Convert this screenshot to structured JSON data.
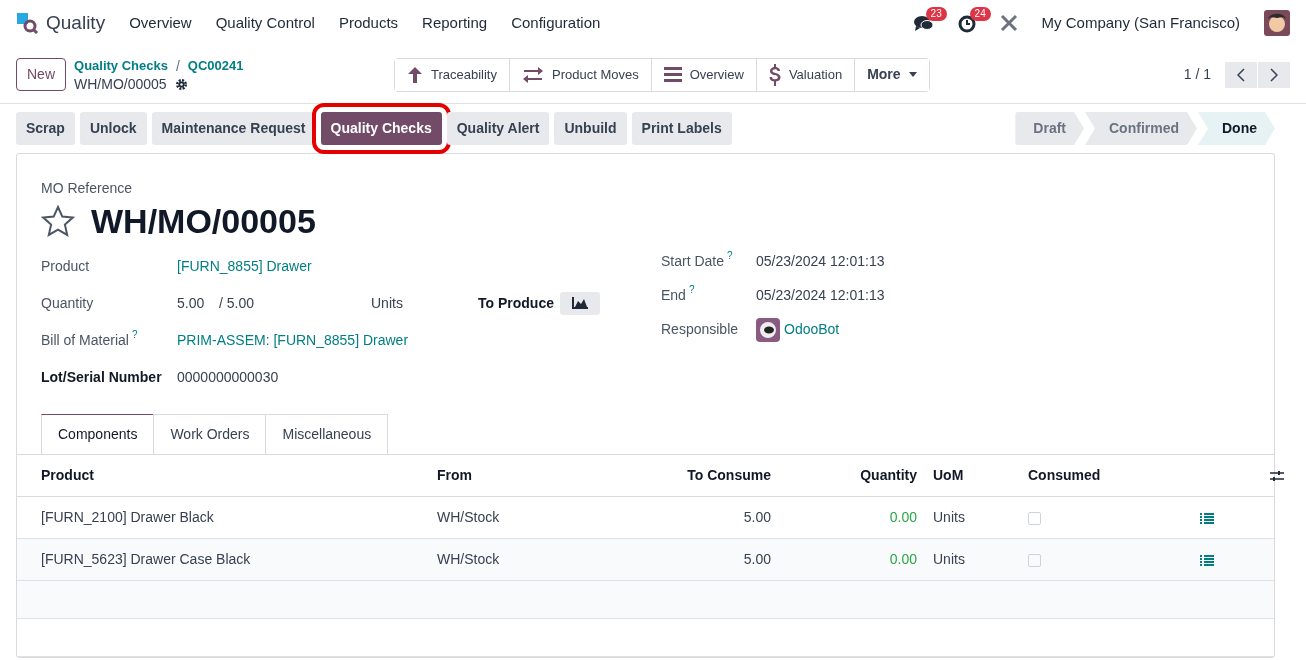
{
  "navbar": {
    "app_name": "Quality",
    "menu": [
      "Overview",
      "Quality Control",
      "Products",
      "Reporting",
      "Configuration"
    ],
    "messages_count": "23",
    "activities_count": "24",
    "company": "My Company (San Francisco)"
  },
  "control_panel": {
    "new_button": "New",
    "breadcrumbs": [
      "Quality Checks",
      "QC00241"
    ],
    "breadcrumb_separator": "/",
    "record": "WH/MO/00005",
    "smart_buttons": [
      {
        "label": "Traceability",
        "kind": "up"
      },
      {
        "label": "Product Moves",
        "kind": "swap"
      },
      {
        "label": "Overview",
        "kind": "list"
      },
      {
        "label": "Valuation",
        "kind": "dollar"
      },
      {
        "label": "More",
        "kind": "more"
      }
    ],
    "pager": "1 / 1"
  },
  "actions": [
    {
      "label": "Scrap",
      "selected": false,
      "highlighted": false
    },
    {
      "label": "Unlock",
      "selected": false,
      "highlighted": false
    },
    {
      "label": "Maintenance Request",
      "selected": false,
      "highlighted": false
    },
    {
      "label": "Quality Checks",
      "selected": true,
      "highlighted": true
    },
    {
      "label": "Quality Alert",
      "selected": false,
      "highlighted": false
    },
    {
      "label": "Unbuild",
      "selected": false,
      "highlighted": false
    },
    {
      "label": "Print Labels",
      "selected": false,
      "highlighted": false
    }
  ],
  "statusbar": [
    {
      "label": "Draft",
      "selected": false
    },
    {
      "label": "Confirmed",
      "selected": false
    },
    {
      "label": "Done",
      "selected": true
    }
  ],
  "sheet": {
    "reference_label": "MO Reference",
    "title": "WH/MO/00005",
    "starred": false,
    "left_fields": [
      {
        "label": "Product",
        "kind": "link",
        "value": "[FURN_8855] Drawer",
        "bold": false
      },
      {
        "label": "Quantity",
        "kind": "quantity",
        "value": "5.00",
        "total": "/ 5.00",
        "uom": "Units",
        "extra_label": "To Produce",
        "bold": false
      },
      {
        "label": "Bill of Material",
        "kind": "link",
        "value": "PRIM-ASSEM: [FURN_8855] Drawer",
        "help": "?",
        "bold": false
      },
      {
        "label": "Lot/Serial Number",
        "kind": "text",
        "value": "0000000000030",
        "bold": true
      }
    ],
    "right_fields": [
      {
        "label": "Start Date",
        "kind": "text",
        "value": "05/23/2024 12:01:13",
        "help": "?",
        "bold": false
      },
      {
        "label": "End",
        "kind": "text",
        "value": "05/23/2024 12:01:13",
        "help": "?",
        "bold": false
      },
      {
        "label": "Responsible",
        "kind": "user",
        "value": "OdooBot",
        "bold": false
      }
    ]
  },
  "tabs": [
    {
      "label": "Components",
      "selected": true
    },
    {
      "label": "Work Orders",
      "selected": false
    },
    {
      "label": "Miscellaneous",
      "selected": false
    }
  ],
  "table": {
    "columns": [
      "Product",
      "From",
      "To Consume",
      "Quantity",
      "UoM",
      "Consumed"
    ],
    "rows": [
      {
        "product": "[FURN_2100] Drawer Black",
        "from": "WH/Stock",
        "to_consume": "5.00",
        "quantity": "0.00",
        "uom": "Units",
        "consumed": false
      },
      {
        "product": "[FURN_5623] Drawer Case Black",
        "from": "WH/Stock",
        "to_consume": "5.00",
        "quantity": "0.00",
        "uom": "Units",
        "consumed": false
      }
    ]
  }
}
